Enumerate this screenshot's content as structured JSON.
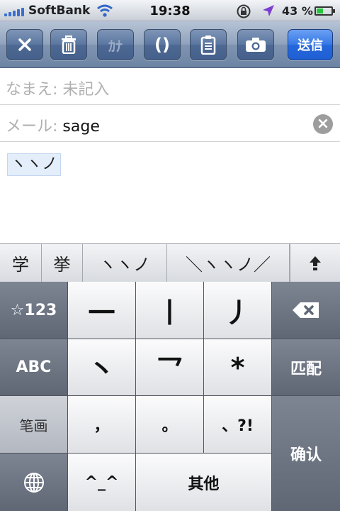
{
  "status_bar": {
    "carrier": "SoftBank",
    "time": "19:38",
    "battery_label": "43 %",
    "battery_level": 0.43,
    "battery_color": "#27c53a"
  },
  "toolbar": {
    "buttons": [
      {
        "id": "close",
        "label": "✕",
        "icon": "close-icon"
      },
      {
        "id": "trash",
        "icon": "trash-icon"
      },
      {
        "id": "kana",
        "label": "ｶﾅ",
        "disabled": true
      },
      {
        "id": "paren",
        "label": "()"
      },
      {
        "id": "clipboard",
        "icon": "clipboard-icon"
      },
      {
        "id": "camera",
        "icon": "camera-icon"
      }
    ],
    "send_label": "送信",
    "accent": "#2467dc"
  },
  "form": {
    "name_label": "なまえ:",
    "name_placeholder": "未記入",
    "mail_label": "メール:",
    "mail_value": "sage",
    "clear_label": "×",
    "body": "ヽヽノ"
  },
  "candidates": [
    "学",
    "挙",
    "ヽヽノ",
    "＼ヽヽノ／"
  ],
  "keyboard": {
    "row1": [
      "☆123",
      "一",
      "丨",
      "丿"
    ],
    "row2": [
      "ABC",
      "丶",
      "乛",
      "*",
      "匹配"
    ],
    "row3": [
      "笔画",
      "，",
      "。",
      "、?!"
    ],
    "row4": [
      "^_^",
      "其他"
    ],
    "confirm": "确认"
  }
}
